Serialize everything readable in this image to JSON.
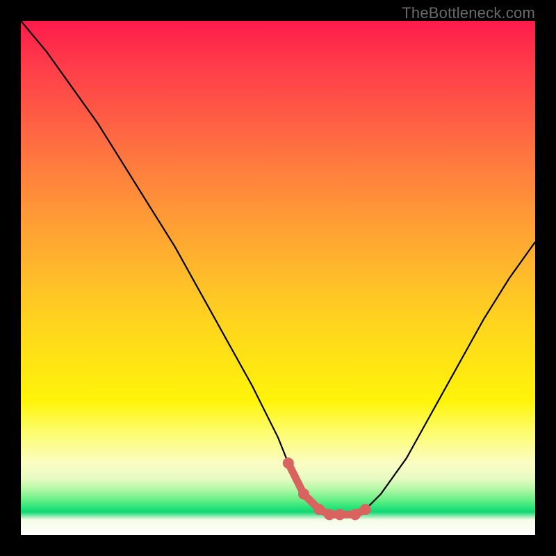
{
  "watermark": "TheBottleneck.com",
  "colors": {
    "background": "#000000",
    "curve": "#000000",
    "marker": "#d9635f",
    "gradient_stops": [
      "#ff1a4b",
      "#ff9a36",
      "#ffe812",
      "#fbfcc4",
      "#2ee57a",
      "#ffffff"
    ]
  },
  "chart_data": {
    "type": "line",
    "title": "",
    "xlabel": "",
    "ylabel": "",
    "xlim": [
      0,
      100
    ],
    "ylim": [
      0,
      100
    ],
    "series": [
      {
        "name": "bottleneck-curve",
        "x": [
          0,
          5,
          10,
          15,
          20,
          25,
          30,
          35,
          40,
          45,
          50,
          52,
          55,
          58,
          60,
          62,
          65,
          67,
          70,
          75,
          80,
          85,
          90,
          95,
          100
        ],
        "values": [
          100,
          94,
          87,
          80,
          72,
          64,
          56,
          47,
          38,
          29,
          19,
          14,
          8,
          5,
          4,
          4,
          4,
          5,
          8,
          15,
          24,
          33,
          42,
          50,
          57
        ]
      }
    ],
    "markers": {
      "name": "highlighted-segment",
      "x": [
        52,
        55,
        58,
        60,
        62,
        65,
        67
      ],
      "values": [
        14,
        8,
        5,
        4,
        4,
        4,
        5
      ]
    }
  }
}
